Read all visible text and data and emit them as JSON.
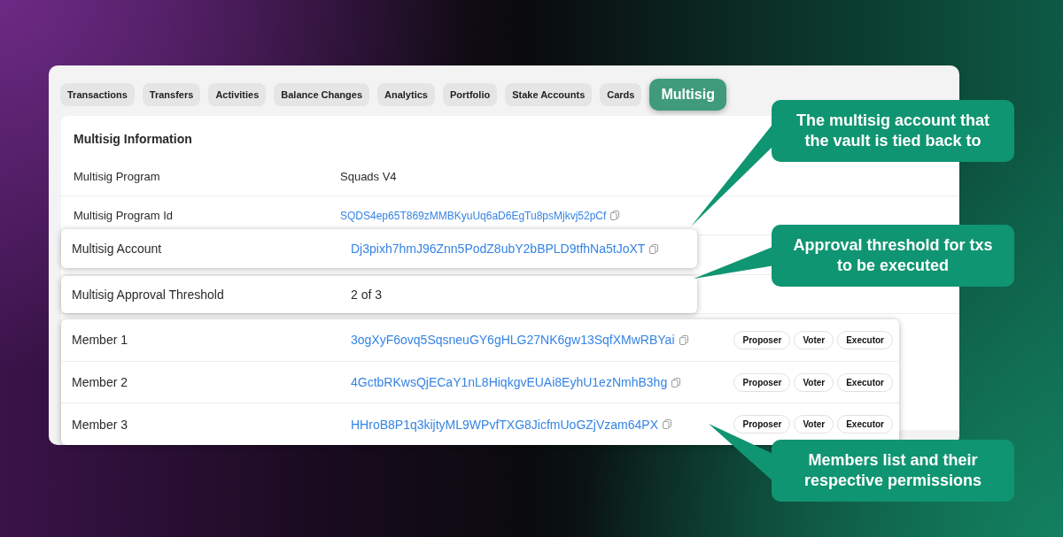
{
  "tabs": [
    {
      "label": "Transactions",
      "selected": false
    },
    {
      "label": "Transfers",
      "selected": false
    },
    {
      "label": "Activities",
      "selected": false
    },
    {
      "label": "Balance Changes",
      "selected": false
    },
    {
      "label": "Analytics",
      "selected": false
    },
    {
      "label": "Portfolio",
      "selected": false
    },
    {
      "label": "Stake Accounts",
      "selected": false
    },
    {
      "label": "Cards",
      "selected": false
    },
    {
      "label": "Multisig",
      "selected": true
    }
  ],
  "info": {
    "title": "Multisig Information",
    "rows": [
      {
        "label": "Multisig Program",
        "kind": "text",
        "value": "Squads V4"
      },
      {
        "label": "Multisig Program Id",
        "kind": "address",
        "value": "SQDS4ep65T869zMMBKyuUq6aD6EgTu8psMjkvj52pCf"
      }
    ]
  },
  "highlighted_rows": [
    {
      "label": "Multisig Account",
      "kind": "address",
      "value": "Dj3pixh7hmJ96Znn5PodZ8ubY2bBPLD9tfhNa5tJoXT"
    },
    {
      "label": "Multisig Approval Threshold",
      "kind": "text",
      "value": "2 of 3"
    }
  ],
  "members": [
    {
      "label": "Member 1",
      "address": "3ogXyF6ovq5SqsneuGY6gHLG27NK6gw13SqfXMwRBYai",
      "roles": [
        "Proposer",
        "Voter",
        "Executor"
      ]
    },
    {
      "label": "Member 2",
      "address": "4GctbRKwsQjECaY1nL8HiqkgvEUAi8EyhU1ezNmhB3hg",
      "roles": [
        "Proposer",
        "Voter",
        "Executor"
      ]
    },
    {
      "label": "Member 3",
      "address": "HHroB8P1q3kijtyML9WPvfTXG8JicfmUoGZjVzam64PX",
      "roles": [
        "Proposer",
        "Voter",
        "Executor"
      ]
    }
  ],
  "callouts": [
    {
      "text": "The multisig account that the vault is tied back to"
    },
    {
      "text": "Approval threshold for txs to be executed"
    },
    {
      "text": "Members list and their respective permissions"
    }
  ]
}
